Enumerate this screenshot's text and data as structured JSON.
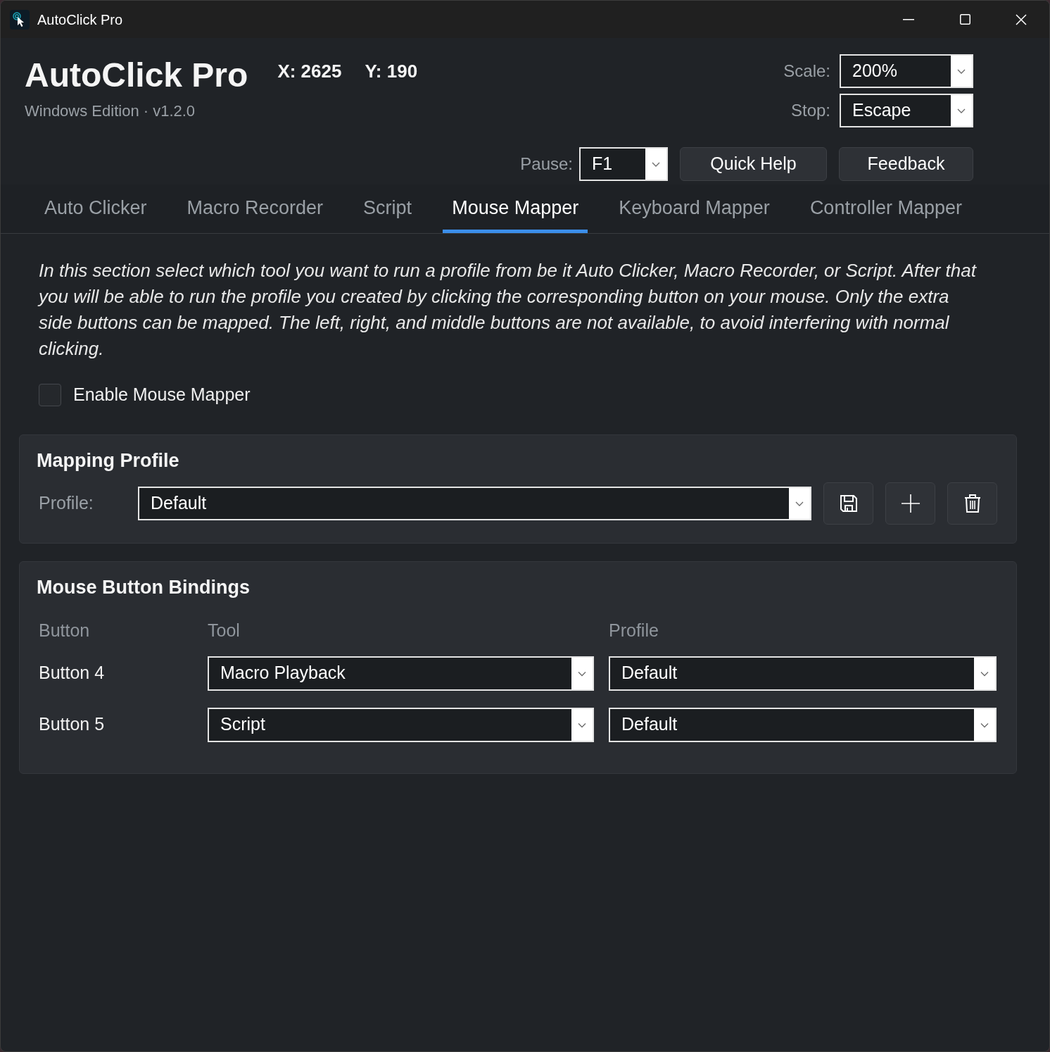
{
  "window": {
    "title": "AutoClick Pro"
  },
  "header": {
    "title": "AutoClick Pro",
    "subtitle": "Windows Edition · v1.2.0",
    "readouts": [
      "X: 2625",
      "Y: 190"
    ]
  },
  "settings": [
    {
      "label": "Scale:",
      "value": "200%"
    },
    {
      "label": "Stop:",
      "value": "Escape"
    }
  ],
  "pause": {
    "label": "Pause:",
    "value": "F1"
  },
  "header_buttons": [
    "Quick Help",
    "Feedback"
  ],
  "tabs": [
    {
      "label": "Auto Clicker",
      "selected": false
    },
    {
      "label": "Macro Recorder",
      "selected": false
    },
    {
      "label": "Script",
      "selected": false
    },
    {
      "label": "Mouse Mapper",
      "selected": true
    },
    {
      "label": "Keyboard Mapper",
      "selected": false
    },
    {
      "label": "Controller Mapper",
      "selected": false
    }
  ],
  "description": "In this section select which tool you want to run a profile from be it Auto Clicker, Macro Recorder, or Script. After that you will be able to run the profile you created by clicking the corresponding button on your mouse. Only the extra side buttons can be mapped. The left, right, and middle buttons are not available, to avoid interfering with normal clicking.",
  "enable_checkbox": {
    "label": "Enable Mouse Mapper",
    "checked": false
  },
  "mapping_profile": {
    "title": "Mapping Profile",
    "label": "Profile:",
    "value": "Default"
  },
  "bindings": {
    "title": "Mouse Button Bindings",
    "columns": [
      "Button",
      "Tool",
      "Profile"
    ],
    "rows": [
      {
        "button": "Button 4",
        "tool": "Macro Playback",
        "profile": "Default"
      },
      {
        "button": "Button 5",
        "tool": "Script",
        "profile": "Default"
      }
    ]
  }
}
